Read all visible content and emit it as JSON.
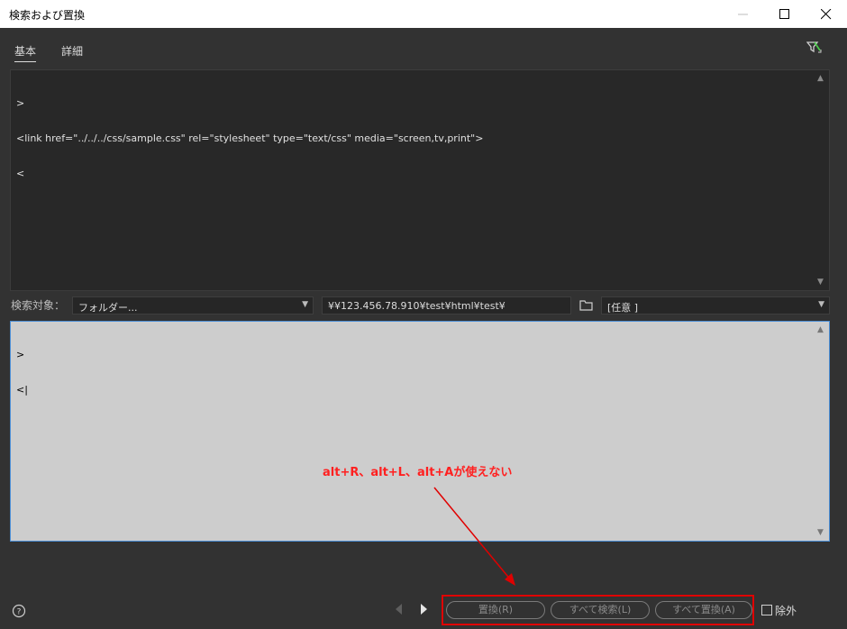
{
  "window": {
    "title": "検索および置換"
  },
  "tabs": [
    {
      "label": "基本",
      "active": true
    },
    {
      "label": "詳細",
      "active": false
    }
  ],
  "find_editor": {
    "lines": [
      ">",
      "<link href=\"../../../css/sample.css\" rel=\"stylesheet\" type=\"text/css\" media=\"screen,tv,print\">",
      "<"
    ]
  },
  "search_target": {
    "label": "検索対象：",
    "scope": "フォルダー...",
    "path": "¥¥123.456.78.910¥test¥html¥test¥",
    "filter": "[任意 ]"
  },
  "replace_editor": {
    "lines": [
      ">",
      "<|"
    ]
  },
  "annotation": {
    "text": "alt+R、alt+L、alt+Aが使えない",
    "color": "#ff2020"
  },
  "buttons": {
    "replace": "置換(R)",
    "find_all": "すべて検索(L)",
    "replace_all": "すべて置換(A)"
  },
  "exclude": {
    "label": "除外",
    "checked": false
  },
  "icons": {
    "minimize": "minimize-icon",
    "maximize": "maximize-icon",
    "close": "close-icon",
    "filter": "filter-icon",
    "folder": "folder-icon",
    "help": "help-icon",
    "prev": "prev-arrow-icon",
    "next": "next-arrow-icon"
  }
}
